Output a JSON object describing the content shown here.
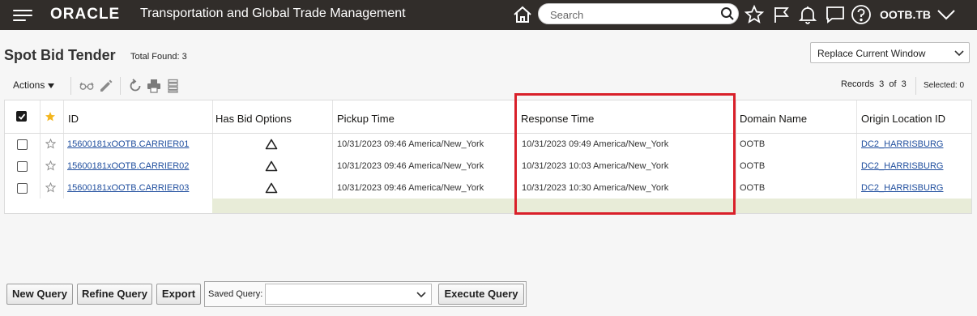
{
  "header": {
    "brand": "ORACLE",
    "app_title": "Transportation and Global Trade Management",
    "search_placeholder": "Search",
    "user": "OOTB.TB"
  },
  "page": {
    "title": "Spot Bid Tender",
    "total_found": "Total Found: 3",
    "window_option": "Replace Current Window"
  },
  "toolbar": {
    "actions_label": "Actions",
    "records_label": "Records",
    "records_current": "3",
    "records_of": "of",
    "records_total": "3",
    "selected_label": "Selected: 0"
  },
  "table": {
    "columns": [
      "ID",
      "Has Bid Options",
      "Pickup Time",
      "Response Time",
      "Domain Name",
      "Origin Location ID"
    ],
    "rows": [
      {
        "id": "15600181xOOTB.CARRIER01",
        "pickup": "10/31/2023 09:46 America/New_York",
        "response": "10/31/2023 09:49 America/New_York",
        "domain": "OOTB",
        "origin": "DC2_HARRISBURG"
      },
      {
        "id": "15600181xOOTB.CARRIER02",
        "pickup": "10/31/2023 09:46 America/New_York",
        "response": "10/31/2023 10:03 America/New_York",
        "domain": "OOTB",
        "origin": "DC2_HARRISBURG"
      },
      {
        "id": "15600181xOOTB.CARRIER03",
        "pickup": "10/31/2023 09:46 America/New_York",
        "response": "10/31/2023 10:30 America/New_York",
        "domain": "OOTB",
        "origin": "DC2_HARRISBURG"
      }
    ]
  },
  "query_bar": {
    "new_query": "New Query",
    "refine_query": "Refine Query",
    "export": "Export",
    "saved_query_label": "Saved Query:",
    "saved_query_value": "",
    "execute_query": "Execute Query"
  },
  "colors": {
    "header_bg": "#312d2a",
    "link": "#1f4e9e",
    "highlight": "#d9202a"
  }
}
